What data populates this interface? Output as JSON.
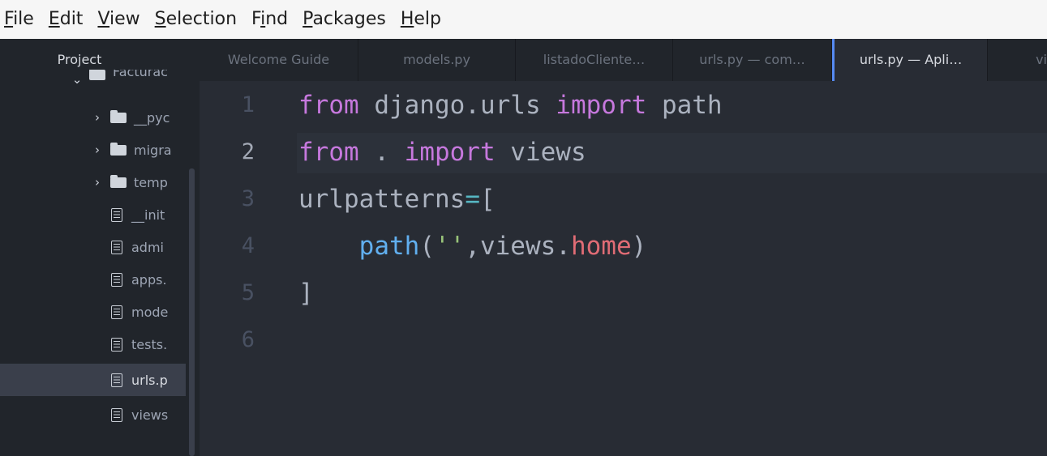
{
  "menu": [
    {
      "pre": "",
      "mn": "F",
      "post": "ile"
    },
    {
      "pre": "",
      "mn": "E",
      "post": "dit"
    },
    {
      "pre": "",
      "mn": "V",
      "post": "iew"
    },
    {
      "pre": "",
      "mn": "S",
      "post": "election"
    },
    {
      "pre": "F",
      "mn": "i",
      "post": "nd"
    },
    {
      "pre": "",
      "mn": "P",
      "post": "ackages"
    },
    {
      "pre": "",
      "mn": "H",
      "post": "elp"
    }
  ],
  "tree": {
    "header": "Project",
    "root": "Facturac",
    "items": [
      {
        "type": "folder",
        "label": "__pyc"
      },
      {
        "type": "folder",
        "label": "migra"
      },
      {
        "type": "folder",
        "label": "temp"
      },
      {
        "type": "file",
        "label": "__init"
      },
      {
        "type": "file",
        "label": "admi"
      },
      {
        "type": "file",
        "label": "apps."
      },
      {
        "type": "file",
        "label": "mode"
      },
      {
        "type": "file",
        "label": "tests."
      },
      {
        "type": "file",
        "label": "urls.p"
      },
      {
        "type": "file",
        "label": "views"
      }
    ]
  },
  "tabs": [
    {
      "label": "Welcome Guide"
    },
    {
      "label": "models.py"
    },
    {
      "label": "listadoCliente…"
    },
    {
      "label": "urls.py — com…"
    },
    {
      "label": "urls.py — Apli…"
    },
    {
      "label": "vi"
    }
  ],
  "editor": {
    "line_numbers": [
      "1",
      "2",
      "3",
      "4",
      "5",
      "6"
    ],
    "cursor_line": 2,
    "code": {
      "l1": {
        "kw1": "from",
        "t1": " django.urls ",
        "kw2": "import",
        "t2": " path"
      },
      "l2": {
        "kw1": "from",
        "t1": " . ",
        "kw2": "import",
        "t2": " views"
      },
      "l3": {
        "t1": "urlpatterns",
        "op": "=",
        "t2": "["
      },
      "l4": {
        "indent": "    ",
        "fn": "path",
        "t1": "(",
        "str": "''",
        "t2": ",views.",
        "prop": "home",
        "t3": ")"
      },
      "l5": {
        "t1": "]"
      }
    }
  },
  "colors": {
    "keyword": "#c678dd",
    "function": "#61afef",
    "string": "#98c379",
    "property": "#e06c75",
    "operator": "#56b6c2",
    "active_tab_accent": "#568af2"
  }
}
